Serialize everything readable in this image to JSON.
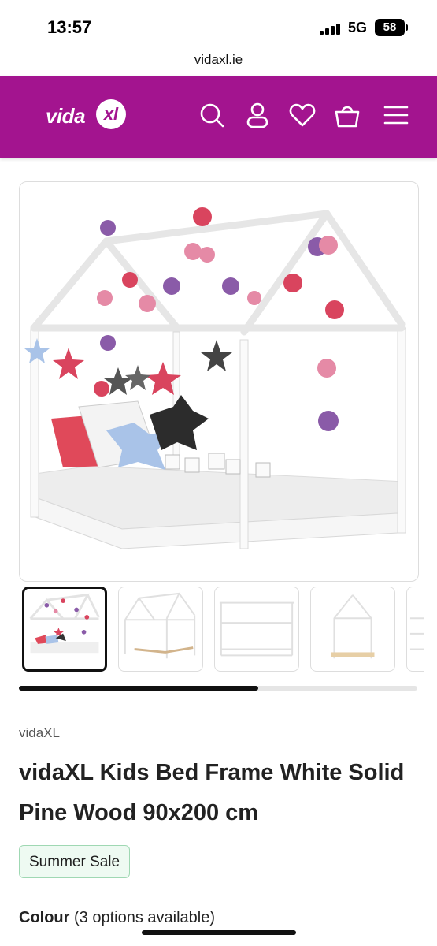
{
  "status_bar": {
    "time": "13:57",
    "network": "5G",
    "battery": "58",
    "signal_bars": 4
  },
  "browser": {
    "url": "vidaxl.ie"
  },
  "header": {
    "logo_text": "vida",
    "logo_mark": "xl",
    "icons": [
      "search-icon",
      "account-icon",
      "wishlist-heart-icon",
      "cart-basket-icon",
      "menu-hamburger-icon"
    ],
    "background_color": "#a3148f"
  },
  "gallery": {
    "main_image": "product-photo-house-bed-with-decorations",
    "thumbnails": [
      {
        "label": "decorated-bed-photo",
        "active": true
      },
      {
        "label": "bed-frame-angle-view",
        "active": false
      },
      {
        "label": "bed-frame-front-view",
        "active": false
      },
      {
        "label": "bed-frame-side-view",
        "active": false
      },
      {
        "label": "bed-frame-partial",
        "active": false
      }
    ],
    "scroll_progress": 0.6
  },
  "product": {
    "brand": "vidaXL",
    "title": "vidaXL Kids Bed Frame White Solid Pine Wood 90x200 cm",
    "badge": "Summer Sale",
    "colour_label": "Colour",
    "colour_options": "(3 options available)"
  }
}
